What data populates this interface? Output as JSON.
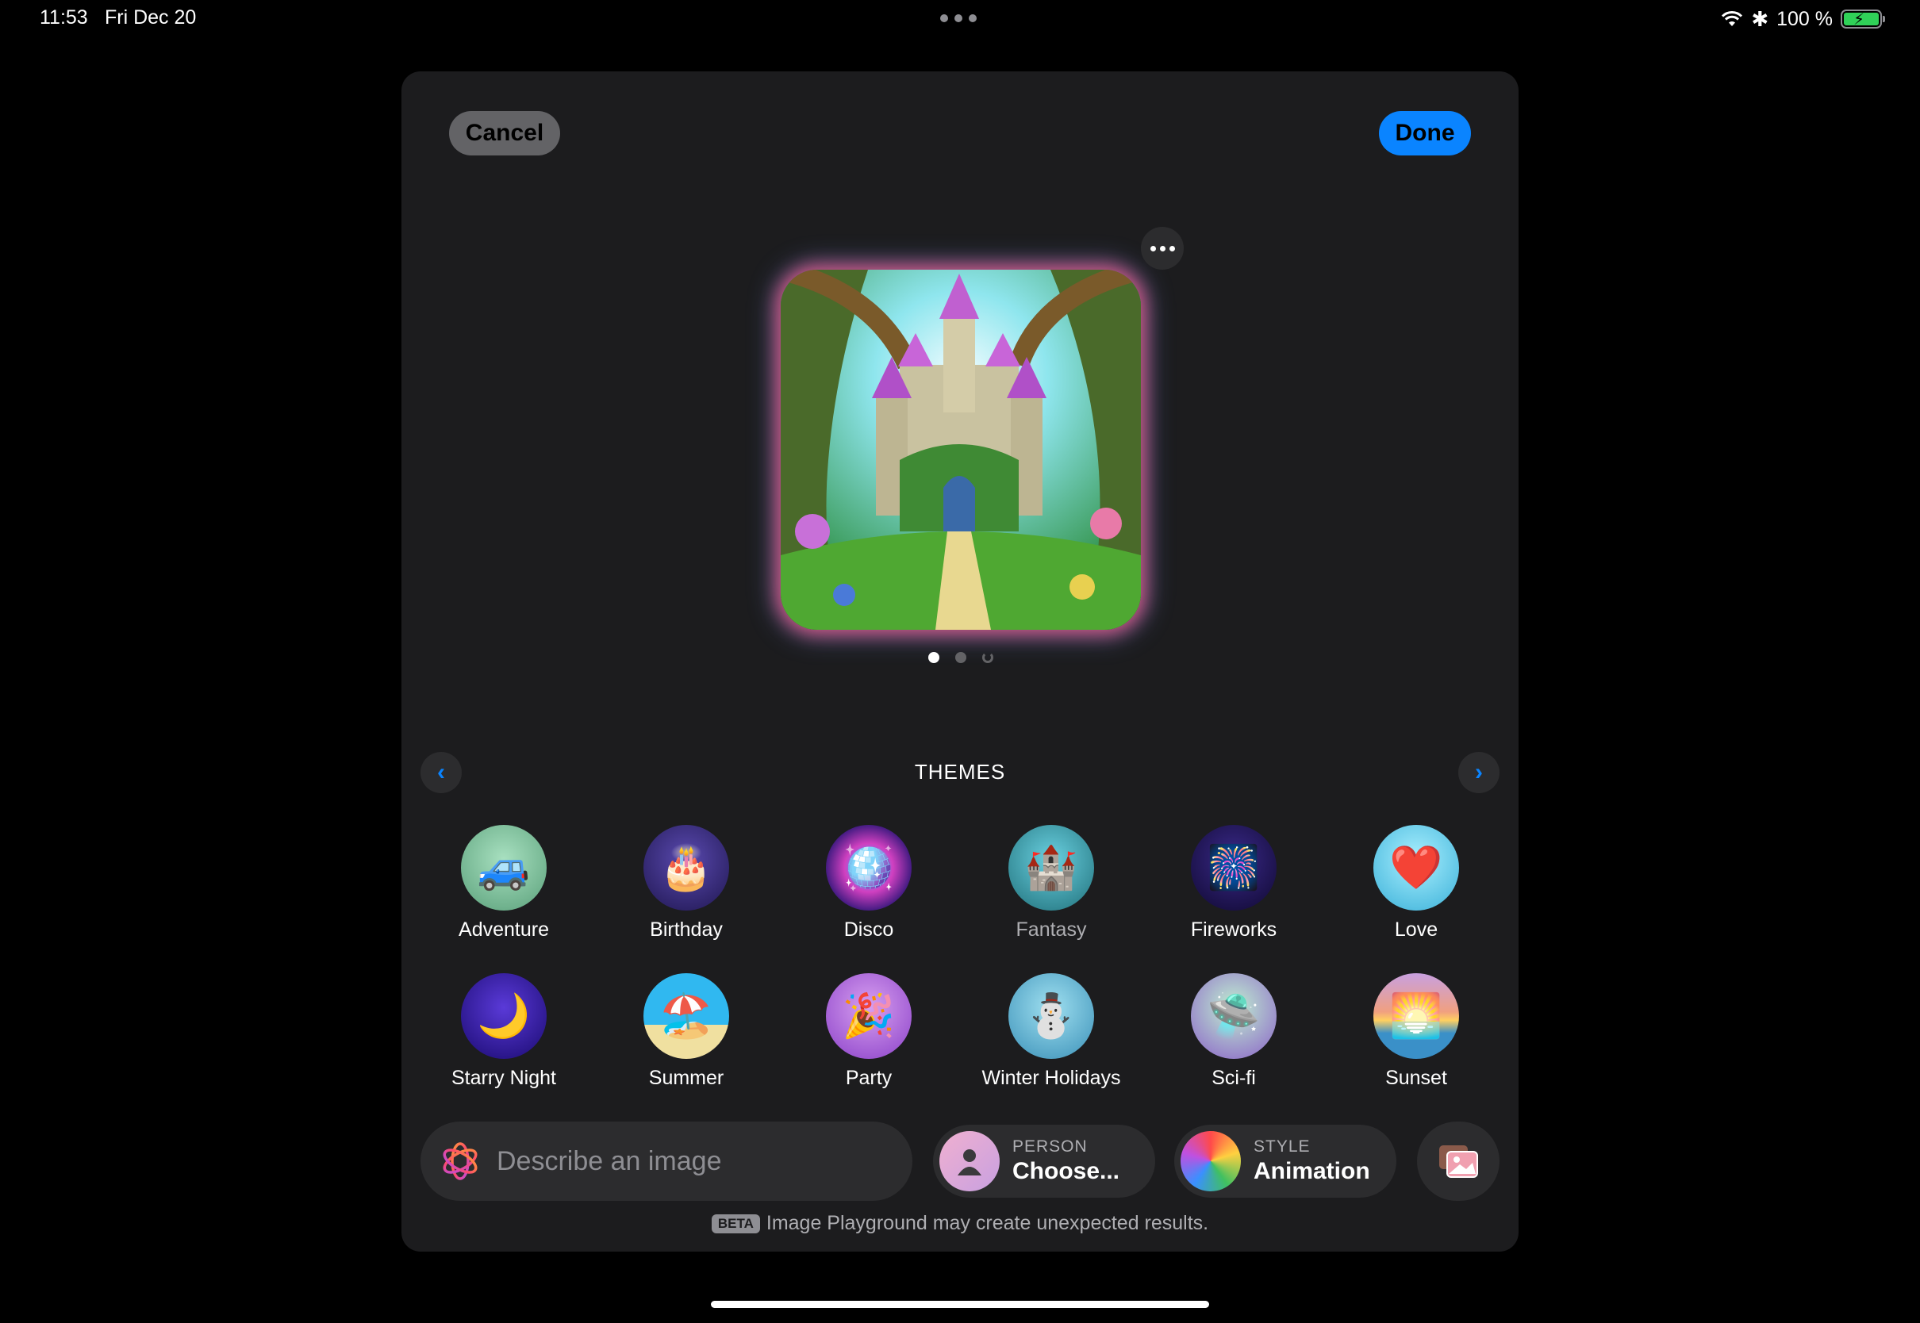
{
  "status_bar": {
    "time": "11:53",
    "date": "Fri Dec 20",
    "battery_text": "100 %",
    "icons": [
      "wifi-icon",
      "bluetooth-icon",
      "battery-charging-icon"
    ]
  },
  "sheet": {
    "cancel_label": "Cancel",
    "done_label": "Done"
  },
  "preview": {
    "image_description_icon": "fantasy-castle-image",
    "pages": 3,
    "active_page": 1
  },
  "themes": {
    "title": "THEMES",
    "items": [
      {
        "label": "Adventure",
        "icon": "jeep-icon",
        "bg": "#7bbf9a"
      },
      {
        "label": "Birthday",
        "icon": "cake-icon",
        "bg": "#3a2b7a"
      },
      {
        "label": "Disco",
        "icon": "disco-ball-icon",
        "bg": "#1d1f7a"
      },
      {
        "label": "Fantasy",
        "icon": "castle-island-icon",
        "bg": "#2e8a9a"
      },
      {
        "label": "Fireworks",
        "icon": "fireworks-icon",
        "bg": "#2a1a5a"
      },
      {
        "label": "Love",
        "icon": "heart-balloon-icon",
        "bg": "#4ec8e0"
      },
      {
        "label": "Starry Night",
        "icon": "moon-stars-icon",
        "bg": "#3b1fa8"
      },
      {
        "label": "Summer",
        "icon": "beach-chair-icon",
        "bg": "#21a6d8"
      },
      {
        "label": "Party",
        "icon": "party-popper-icon",
        "bg": "#a86bd8"
      },
      {
        "label": "Winter Holidays",
        "icon": "snowman-icon",
        "bg": "#5aa8c8"
      },
      {
        "label": "Sci-fi",
        "icon": "ufo-icon",
        "bg": "#6ac8a0"
      },
      {
        "label": "Sunset",
        "icon": "sunset-icon",
        "bg": "#e88a7a"
      }
    ]
  },
  "bottom": {
    "prompt_placeholder": "Describe an image",
    "person_kicker": "PERSON",
    "person_value": "Choose...",
    "style_kicker": "STYLE",
    "style_value": "Animation"
  },
  "disclaimer": {
    "badge": "BETA",
    "text": "Image Playground may create unexpected results."
  }
}
